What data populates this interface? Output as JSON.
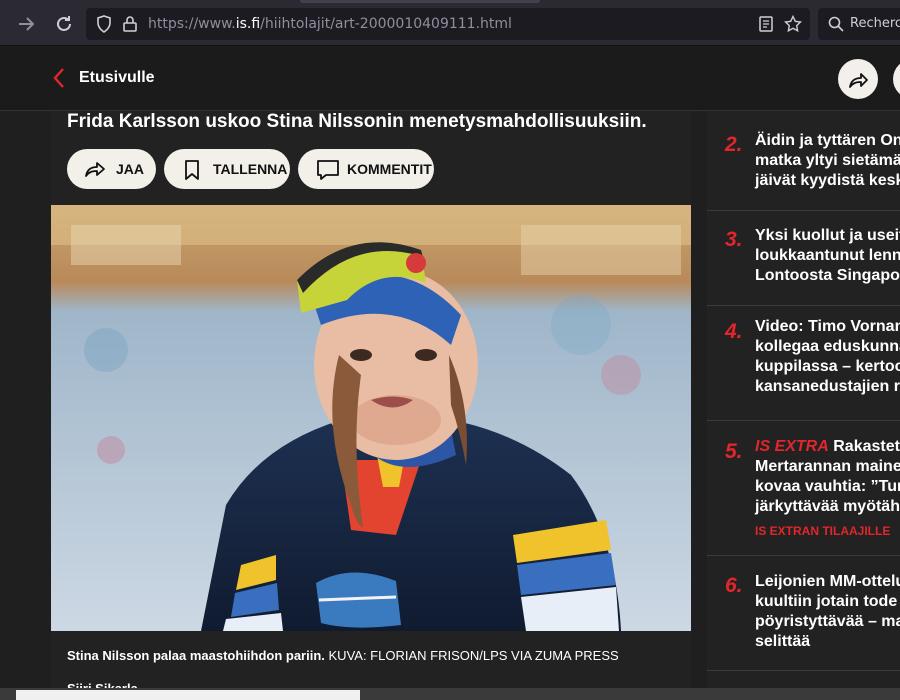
{
  "browser": {
    "url_prefix": "https://www.",
    "url_host": "is.fi",
    "url_path": "/hiihtolajit/art-2000010409111.html",
    "search_placeholder": "Recherch"
  },
  "header": {
    "back_label": "Etusivulle"
  },
  "article": {
    "headline": "Frida Karlsson uskoo Stina Nilssonin menetysmahdollisuuksiin.",
    "share_label": "JAA",
    "save_label": "TALLENNA",
    "comments_label": "KOMMENTIT",
    "caption_text": "Stina Nilsson palaa maastohiihdon pariin.",
    "caption_credit": "KUVA: FLORIAN FRISON/LPS VIA ZUMA PRESS",
    "author": "Siiri Sikarla"
  },
  "sidebar": {
    "items": [
      {
        "num": "2.",
        "title": "Äidin ja tyttären On\nmatka yltyi sietämä\njäivät kyydistä kesk"
      },
      {
        "num": "3.",
        "title": "Yksi kuollut ja useit\nloukkaantunut lenn\nLontoosta Singapor"
      },
      {
        "num": "4.",
        "title": "Video: Timo Vornan\nkollegaa eduskunna\nkuppilassa – kertoo\nkansanedustajien r"
      },
      {
        "num": "5.",
        "extra": "IS EXTRA",
        "title": " Rakastet\nMertarannan maine\nkovaa vauhtia: ”Tur\njärkyttävää myötäh",
        "sub": "IS EXTRAN TILAAJILLE"
      },
      {
        "num": "6.",
        "title": "Leijonien MM-ottelu\nkuultiin jotain tode\npöyristyttävää – ma\nselittää"
      }
    ]
  },
  "colors": {
    "accent_red": "#e2262b",
    "button_bg": "#f3efe9",
    "page_bg": "#1f1f1f"
  }
}
